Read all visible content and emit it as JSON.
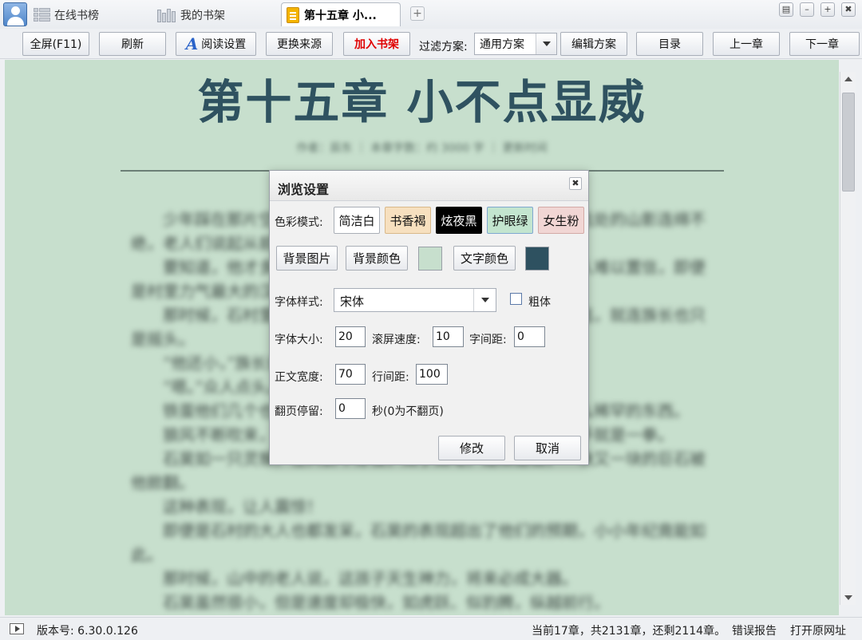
{
  "tabs": {
    "online_rank": "在线书榜",
    "bookshelf": "我的书架",
    "current_chapter": "第十五章 小...",
    "add": "+"
  },
  "window_controls": {
    "menu": "▤",
    "minimize": "–",
    "maximize": "+",
    "close": "✖"
  },
  "toolbar": {
    "fullscreen": "全屏(F11)",
    "refresh": "刷新",
    "reading_settings": "阅读设置",
    "change_source": "更换来源",
    "add_to_shelf": "加入书架",
    "filter_label": "过滤方案:",
    "filter_value": "通用方案",
    "edit_scheme": "编辑方案",
    "toc": "目录",
    "prev_chapter": "上一章",
    "next_chapter": "下一章"
  },
  "reader": {
    "chapter_title": "第十五章  小不点显威",
    "meta_line": "作者：辰东  ｜  本章字数：约 3000 字  ｜  更新时间",
    "paragraphs": [
      "少年踩在那片空地上，身后的石村在晨光里显得格外安静，远处的山影连绵不绝，老人们说起从前的事。",
      "要知道，他才多大，在那样的年纪就能做到这一步，简直让人难以置信，即便是村里力气最大的汉子也做不到。",
      "那时候，石村里的人都没有想到，这个孩子将来会走得那么远，就连族长也只是摇头。",
      "“他还小，”族长说，“但是他的骨子里有一股劲。”",
      "“嗯。”众人点头。",
      "铁蛋他们几个也都围了过来，一个个瞪大眼睛，似乎在看什么稀罕的东西。",
      "狼风不断吹来，大家屏住了呼吸，小不点却一点也不慌，抬手就是一拳。",
      "石昊如一只灵猴，在人群中穿梭，双手如电，连续击出，一块又一块的巨石被他掀翻。",
      "这种表现，让人震惊！",
      "即便是石村的大人也都发呆，石昊的表现超出了他们的预期，小小年纪竟能如此。",
      "那时候，山中的老人说，这孩子天生神力，将来必成大器。",
      "石昊虽然很小，但是速度却极快，如虎跃、似豹腾，纵越前行。"
    ]
  },
  "dialog": {
    "title": "浏览设置",
    "close": "✖",
    "color_mode_label": "色彩模式:",
    "modes": [
      "简洁白",
      "书香褐",
      "炫夜黑",
      "护眼绿",
      "女生粉"
    ],
    "bg_image": "背景图片",
    "bg_color": "背景颜色",
    "text_color": "文字颜色",
    "bg_swatch": "#c7dfcd",
    "text_swatch": "#2e5160",
    "font_style_label": "字体样式:",
    "font_style_value": "宋体",
    "bold_label": "粗体",
    "font_size_label": "字体大小:",
    "font_size": "20",
    "scroll_speed_label": "滚屏速度:",
    "scroll_speed": "10",
    "letter_spacing_label": "字间距:",
    "letter_spacing": "0",
    "text_width_label": "正文宽度:",
    "text_width": "70",
    "line_height_label": "行间距:",
    "line_height": "100",
    "page_dwell_label": "翻页停留:",
    "page_dwell": "0",
    "page_dwell_hint": "秒(0为不翻页)",
    "ok": "修改",
    "cancel": "取消"
  },
  "status": {
    "version": "版本号: 6.30.0.126",
    "progress": "当前17章，共2131章，还剩2114章。",
    "report_error": "错误报告",
    "open_source_url": "打开原网址"
  },
  "colors": {
    "reader_bg": "#c7dfcd",
    "title_color": "#2f5260",
    "mode_white_bg": "#ffffff",
    "mode_brown_bg": "#f7e0bf",
    "mode_black_bg": "#000000",
    "mode_green_bg": "#c3e5cf",
    "mode_pink_bg": "#f1d6d4",
    "accent_red": "#e00000"
  }
}
